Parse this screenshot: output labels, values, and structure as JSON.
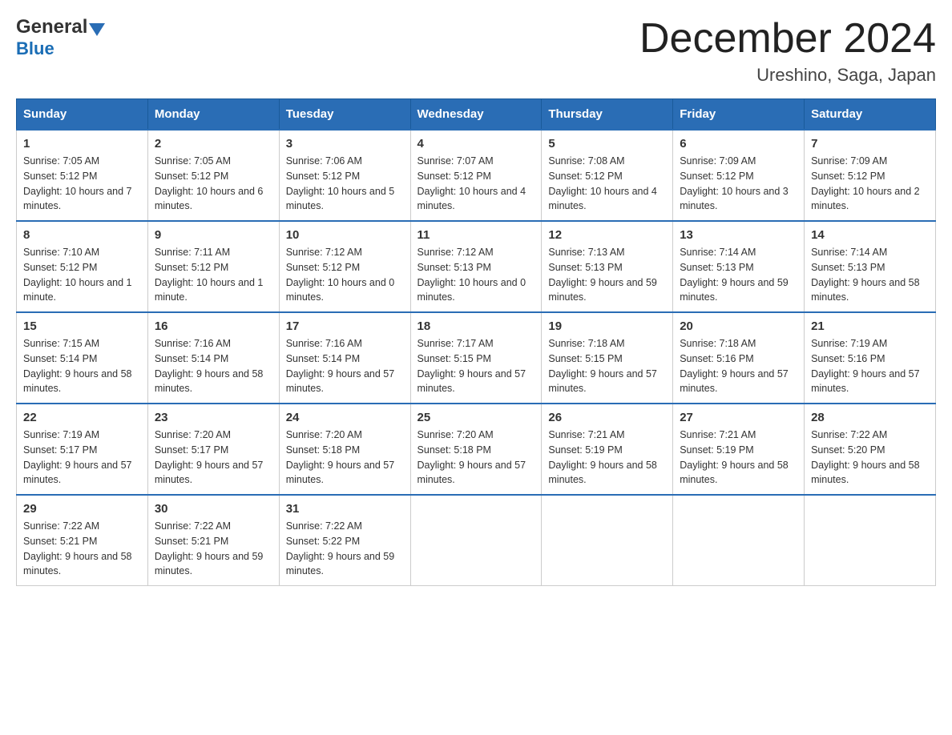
{
  "logo": {
    "general": "General",
    "blue": "Blue",
    "arrow": "▼"
  },
  "title": {
    "month_year": "December 2024",
    "location": "Ureshino, Saga, Japan"
  },
  "days_of_week": [
    "Sunday",
    "Monday",
    "Tuesday",
    "Wednesday",
    "Thursday",
    "Friday",
    "Saturday"
  ],
  "weeks": [
    [
      {
        "day": "1",
        "sunrise": "7:05 AM",
        "sunset": "5:12 PM",
        "daylight": "10 hours and 7 minutes."
      },
      {
        "day": "2",
        "sunrise": "7:05 AM",
        "sunset": "5:12 PM",
        "daylight": "10 hours and 6 minutes."
      },
      {
        "day": "3",
        "sunrise": "7:06 AM",
        "sunset": "5:12 PM",
        "daylight": "10 hours and 5 minutes."
      },
      {
        "day": "4",
        "sunrise": "7:07 AM",
        "sunset": "5:12 PM",
        "daylight": "10 hours and 4 minutes."
      },
      {
        "day": "5",
        "sunrise": "7:08 AM",
        "sunset": "5:12 PM",
        "daylight": "10 hours and 4 minutes."
      },
      {
        "day": "6",
        "sunrise": "7:09 AM",
        "sunset": "5:12 PM",
        "daylight": "10 hours and 3 minutes."
      },
      {
        "day": "7",
        "sunrise": "7:09 AM",
        "sunset": "5:12 PM",
        "daylight": "10 hours and 2 minutes."
      }
    ],
    [
      {
        "day": "8",
        "sunrise": "7:10 AM",
        "sunset": "5:12 PM",
        "daylight": "10 hours and 1 minute."
      },
      {
        "day": "9",
        "sunrise": "7:11 AM",
        "sunset": "5:12 PM",
        "daylight": "10 hours and 1 minute."
      },
      {
        "day": "10",
        "sunrise": "7:12 AM",
        "sunset": "5:12 PM",
        "daylight": "10 hours and 0 minutes."
      },
      {
        "day": "11",
        "sunrise": "7:12 AM",
        "sunset": "5:13 PM",
        "daylight": "10 hours and 0 minutes."
      },
      {
        "day": "12",
        "sunrise": "7:13 AM",
        "sunset": "5:13 PM",
        "daylight": "9 hours and 59 minutes."
      },
      {
        "day": "13",
        "sunrise": "7:14 AM",
        "sunset": "5:13 PM",
        "daylight": "9 hours and 59 minutes."
      },
      {
        "day": "14",
        "sunrise": "7:14 AM",
        "sunset": "5:13 PM",
        "daylight": "9 hours and 58 minutes."
      }
    ],
    [
      {
        "day": "15",
        "sunrise": "7:15 AM",
        "sunset": "5:14 PM",
        "daylight": "9 hours and 58 minutes."
      },
      {
        "day": "16",
        "sunrise": "7:16 AM",
        "sunset": "5:14 PM",
        "daylight": "9 hours and 58 minutes."
      },
      {
        "day": "17",
        "sunrise": "7:16 AM",
        "sunset": "5:14 PM",
        "daylight": "9 hours and 57 minutes."
      },
      {
        "day": "18",
        "sunrise": "7:17 AM",
        "sunset": "5:15 PM",
        "daylight": "9 hours and 57 minutes."
      },
      {
        "day": "19",
        "sunrise": "7:18 AM",
        "sunset": "5:15 PM",
        "daylight": "9 hours and 57 minutes."
      },
      {
        "day": "20",
        "sunrise": "7:18 AM",
        "sunset": "5:16 PM",
        "daylight": "9 hours and 57 minutes."
      },
      {
        "day": "21",
        "sunrise": "7:19 AM",
        "sunset": "5:16 PM",
        "daylight": "9 hours and 57 minutes."
      }
    ],
    [
      {
        "day": "22",
        "sunrise": "7:19 AM",
        "sunset": "5:17 PM",
        "daylight": "9 hours and 57 minutes."
      },
      {
        "day": "23",
        "sunrise": "7:20 AM",
        "sunset": "5:17 PM",
        "daylight": "9 hours and 57 minutes."
      },
      {
        "day": "24",
        "sunrise": "7:20 AM",
        "sunset": "5:18 PM",
        "daylight": "9 hours and 57 minutes."
      },
      {
        "day": "25",
        "sunrise": "7:20 AM",
        "sunset": "5:18 PM",
        "daylight": "9 hours and 57 minutes."
      },
      {
        "day": "26",
        "sunrise": "7:21 AM",
        "sunset": "5:19 PM",
        "daylight": "9 hours and 58 minutes."
      },
      {
        "day": "27",
        "sunrise": "7:21 AM",
        "sunset": "5:19 PM",
        "daylight": "9 hours and 58 minutes."
      },
      {
        "day": "28",
        "sunrise": "7:22 AM",
        "sunset": "5:20 PM",
        "daylight": "9 hours and 58 minutes."
      }
    ],
    [
      {
        "day": "29",
        "sunrise": "7:22 AM",
        "sunset": "5:21 PM",
        "daylight": "9 hours and 58 minutes."
      },
      {
        "day": "30",
        "sunrise": "7:22 AM",
        "sunset": "5:21 PM",
        "daylight": "9 hours and 59 minutes."
      },
      {
        "day": "31",
        "sunrise": "7:22 AM",
        "sunset": "5:22 PM",
        "daylight": "9 hours and 59 minutes."
      },
      null,
      null,
      null,
      null
    ]
  ],
  "labels": {
    "sunrise": "Sunrise:",
    "sunset": "Sunset:",
    "daylight": "Daylight:"
  }
}
